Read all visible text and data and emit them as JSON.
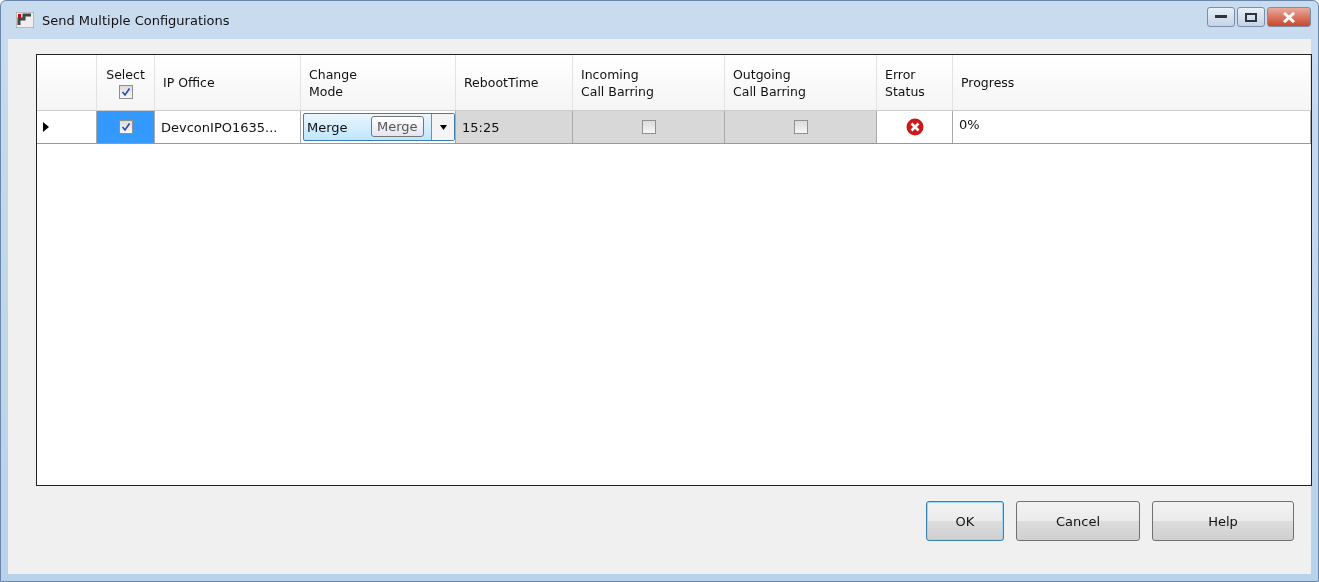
{
  "window": {
    "title": "Send Multiple Configurations"
  },
  "table": {
    "columns": [
      "",
      "Select",
      "IP Office",
      "Change\nMode",
      "RebootTime",
      "Incoming\nCall Barring",
      "Outgoing\nCall Barring",
      "Error\nStatus",
      "Progress"
    ],
    "select_all_checked": true,
    "rows": [
      {
        "current": true,
        "checked": true,
        "ip_office": "DevconIPO1635...",
        "change_mode": "Merge",
        "tooltip": "Merge",
        "reboot_time": "15:25",
        "incoming_call_barring": false,
        "outgoing_call_barring": false,
        "error": true,
        "progress": "0%"
      }
    ]
  },
  "buttons": [
    {
      "label": "OK",
      "default": true
    },
    {
      "label": "Cancel",
      "default": false
    },
    {
      "label": "Help",
      "default": false
    }
  ]
}
